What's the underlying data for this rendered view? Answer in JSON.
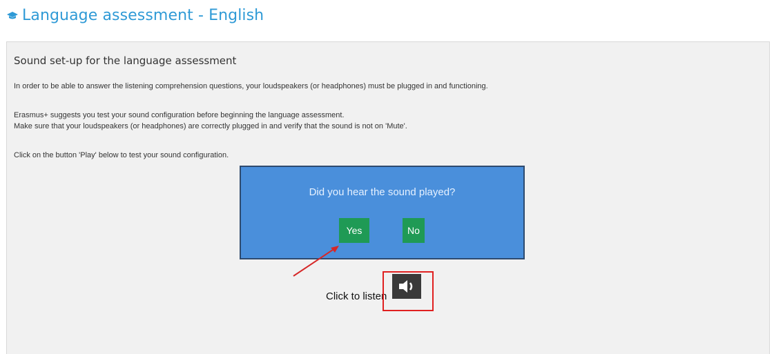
{
  "header": {
    "icon": "graduation-cap-icon",
    "title": "Language assessment - English"
  },
  "panel": {
    "title": "Sound set-up for the language assessment",
    "para1": "In order to be able to answer the listening comprehension questions, your loudspeakers (or headphones) must be plugged in and functioning.",
    "para2": "Erasmus+ suggests you test your sound configuration before beginning the language assessment.",
    "para3": "Make sure that your loudspeakers (or headphones) are correctly plugged in and verify that the sound is not on 'Mute'.",
    "para4": "Click on the button 'Play' below to test your sound configuration."
  },
  "sound_check": {
    "question": "Did you hear the sound played?",
    "yes_label": "Yes",
    "no_label": "No"
  },
  "listen": {
    "label": "Click to listen",
    "icon": "speaker-icon"
  },
  "colors": {
    "accent": "#2f9ad6",
    "panel_bg": "#f1f1f1",
    "box_bg": "#4a8fdb",
    "button_green": "#1f9a55",
    "highlight_red": "#e02020"
  }
}
